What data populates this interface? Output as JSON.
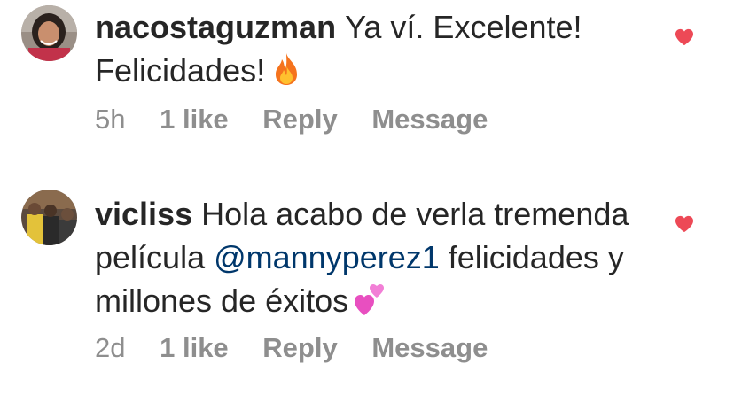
{
  "comments": [
    {
      "username": "nacostaguzman",
      "text": "Ya ví. Excelente! Felicidades!",
      "emoji": "fire-emoji",
      "time": "5h",
      "likes": "1 like",
      "reply_label": "Reply",
      "message_label": "Message",
      "liked": true
    },
    {
      "username": "vicliss",
      "text_before_mention": "Hola acabo de verla tremenda película ",
      "mention": "@mannyperez1",
      "text_after_mention": " felicidades y millones de éxitos",
      "emoji": "two-hearts-emoji",
      "time": "2d",
      "likes": "1 like",
      "reply_label": "Reply",
      "message_label": "Message",
      "liked": true
    }
  ],
  "colors": {
    "text": "#262626",
    "secondary": "#8e8e8e",
    "mention": "#00376b",
    "heart": "#ed4956"
  }
}
